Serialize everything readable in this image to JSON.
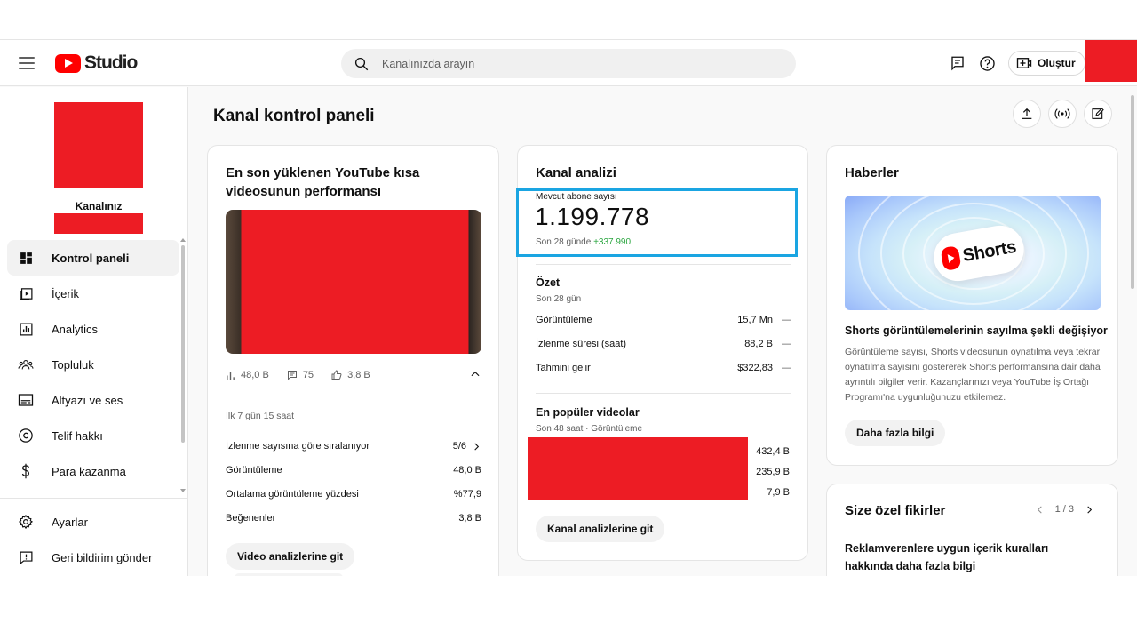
{
  "header": {
    "logo_text": "Studio",
    "search_placeholder": "Kanalınızda arayın",
    "create_label": "Oluştur"
  },
  "sidebar": {
    "channel_name": "Kanalınız",
    "items": [
      {
        "label": "Kontrol paneli",
        "icon": "dashboard-icon"
      },
      {
        "label": "İçerik",
        "icon": "content-icon"
      },
      {
        "label": "Analytics",
        "icon": "analytics-icon"
      },
      {
        "label": "Topluluk",
        "icon": "community-icon"
      },
      {
        "label": "Altyazı ve ses",
        "icon": "subtitles-icon"
      },
      {
        "label": "Telif hakkı",
        "icon": "copyright-icon"
      },
      {
        "label": "Para kazanma",
        "icon": "dollar-icon"
      }
    ],
    "bottom_items": [
      {
        "label": "Ayarlar",
        "icon": "gear-icon"
      },
      {
        "label": "Geri bildirim gönder",
        "icon": "feedback-icon"
      }
    ]
  },
  "main": {
    "title": "Kanal kontrol paneli",
    "latest_video": {
      "title": "En son yüklenen YouTube kısa videosunun performansı",
      "views": "48,0 B",
      "comments": "75",
      "likes": "3,8 B",
      "period": "İlk 7 gün 15 saat",
      "rows": [
        {
          "label": "İzlenme sayısına göre sıralanıyor",
          "value": "5/6"
        },
        {
          "label": "Görüntüleme",
          "value": "48,0 B"
        },
        {
          "label": "Ortalama görüntüleme yüzdesi",
          "value": "%77,9"
        },
        {
          "label": "Beğenenler",
          "value": "3,8 B"
        }
      ],
      "button": "Video analizlerine git"
    },
    "analytics": {
      "title": "Kanal analizi",
      "subscribers_label": "Mevcut abone sayısı",
      "subscribers": "1.199.778",
      "change_prefix": "Son 28 günde",
      "change_value": "+337.990",
      "summary_title": "Özet",
      "summary_period": "Son 28 gün",
      "summary_rows": [
        {
          "label": "Görüntüleme",
          "value": "15,7 Mn",
          "trend": "—"
        },
        {
          "label": "İzlenme süresi (saat)",
          "value": "88,2 B",
          "trend": "—"
        },
        {
          "label": "Tahmini gelir",
          "value": "$322,83",
          "trend": "—"
        }
      ],
      "popular_title": "En popüler videolar",
      "popular_subtitle": "Son 48 saat · Görüntüleme",
      "popular_values": [
        "432,4 B",
        "235,9 B",
        "7,9 B"
      ],
      "button": "Kanal analizlerine git"
    },
    "news": {
      "title": "Haberler",
      "image_label": "Shorts",
      "headline": "Shorts görüntülemelerinin sayılma şekli değişiyor",
      "body": "Görüntüleme sayısı, Shorts videosunun oynatılma veya tekrar oynatılma sayısını göstererek Shorts performansına dair daha ayrıntılı bilgiler verir. Kazançlarınızı veya YouTube İş Ortağı Programı'na uygunluğunuzu etkilemez.",
      "button": "Daha fazla bilgi"
    },
    "ideas": {
      "title": "Size özel fikirler",
      "pager": "1 / 3",
      "text": "Reklamverenlere uygun içerik kuralları hakkında daha fazla bilgi"
    }
  },
  "colors": {
    "brand_red": "#ff0000",
    "redaction": "#ed1c24",
    "highlight_box": "#1aa5e2",
    "positive": "#2ba640"
  }
}
